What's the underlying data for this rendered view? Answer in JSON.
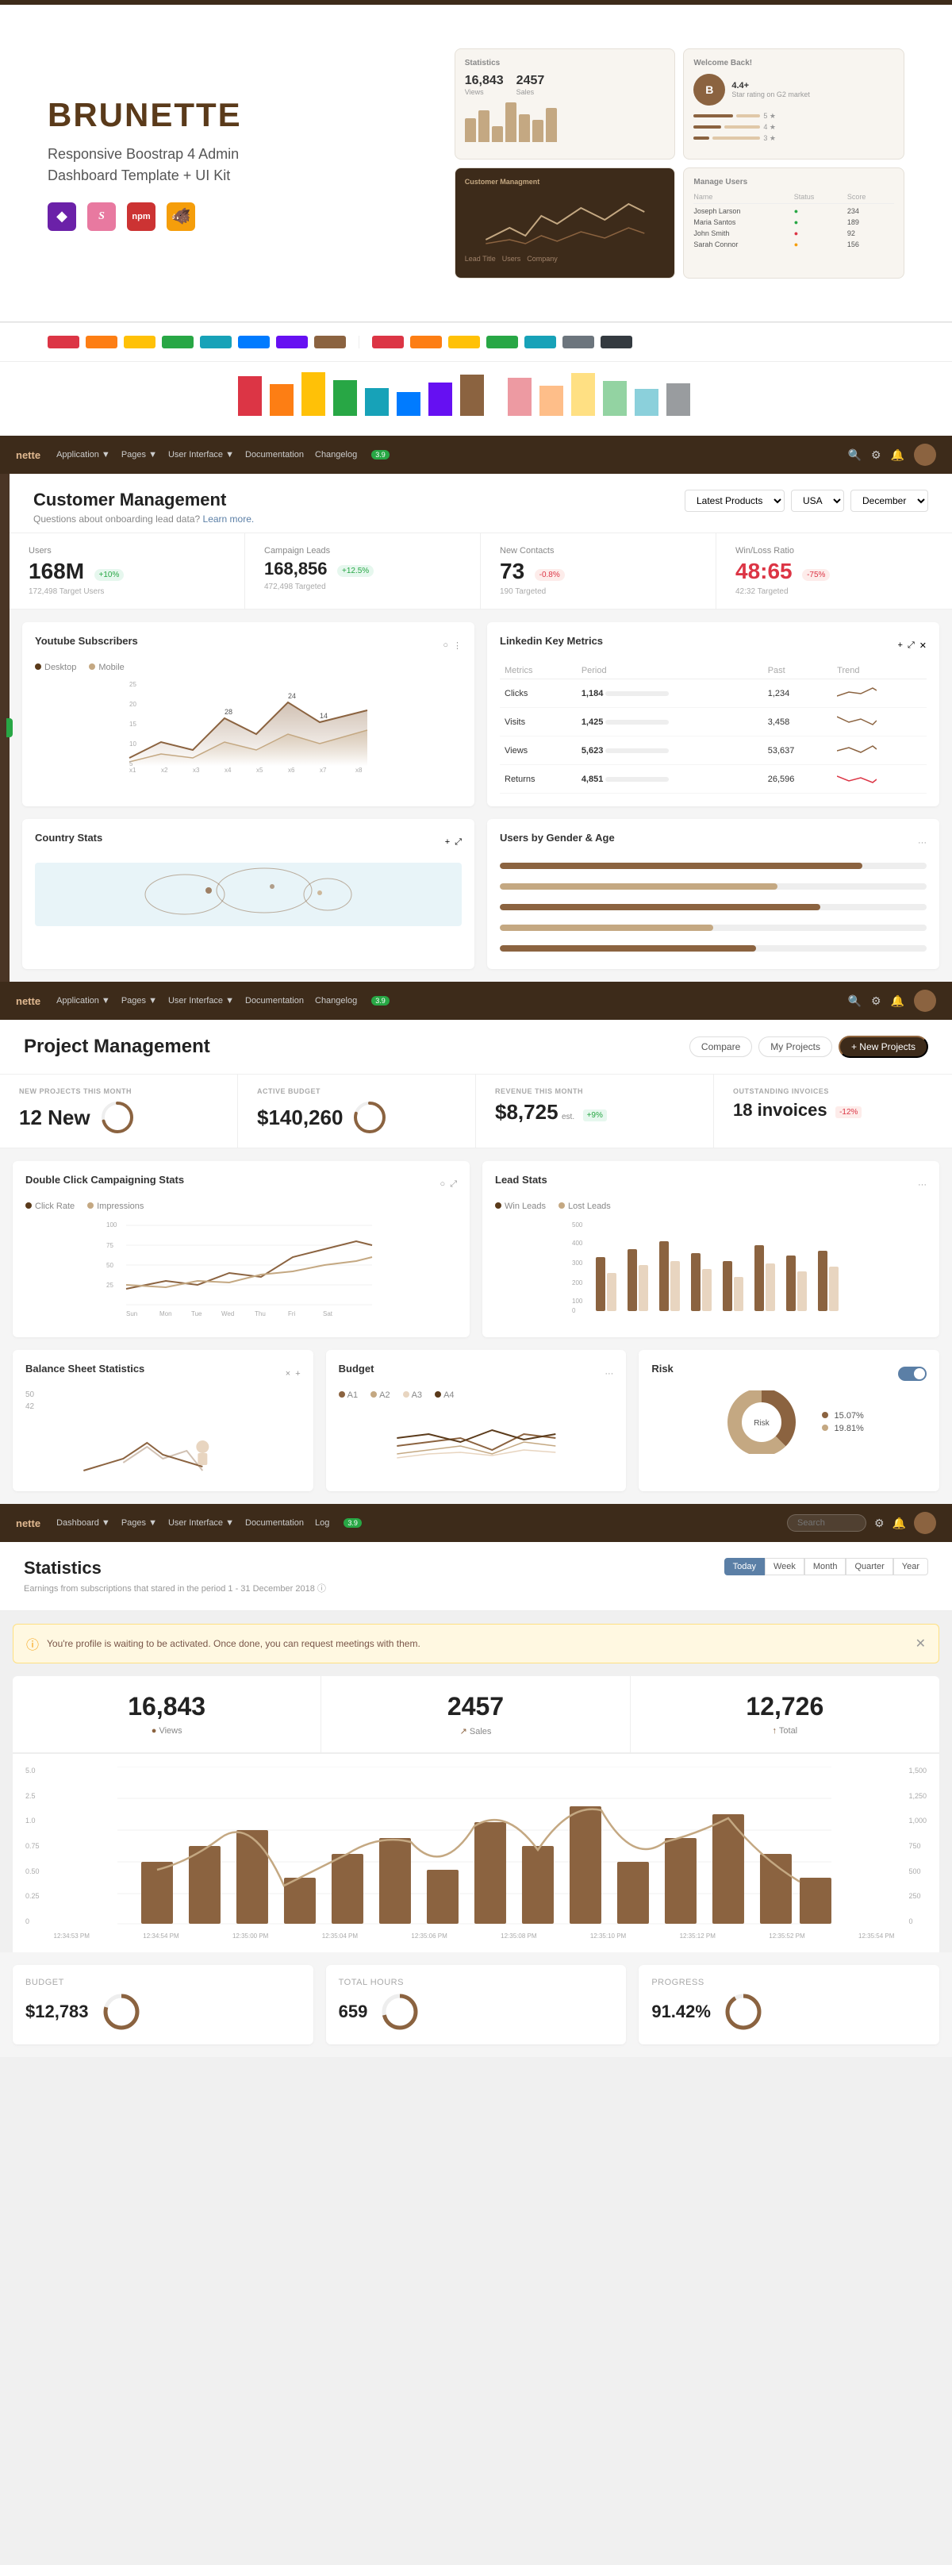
{
  "hero": {
    "title": "BRUNETTE",
    "subtitle_line1": "Responsive Boostrap 4 Admin",
    "subtitle_line2": "Dashboard Template + UI Kit",
    "tech_icons": [
      "◆",
      "Ss",
      "npm",
      "🔧"
    ]
  },
  "customer_management": {
    "title": "Customer Management",
    "subtitle": "Questions about onboarding lead data?",
    "subtitle_link": "Learn more.",
    "filters": {
      "products": "Latest Products",
      "region": "USA",
      "period": "December"
    },
    "stats": [
      {
        "label": "Users",
        "value": "168M",
        "badge": "+10%",
        "badge_type": "green",
        "sub": "172,498 Target Users"
      },
      {
        "label": "Campaign Leads",
        "value": "168,856",
        "badge": "+12.5%",
        "badge_type": "green",
        "sub": "472,498 Targeted"
      },
      {
        "label": "New Contacts",
        "value": "73",
        "badge": "-0.8%",
        "badge_type": "red",
        "sub": "190 Targeted"
      },
      {
        "label": "Win/Loss Ratio",
        "value": "48:65",
        "badge": "-75%",
        "badge_type": "red",
        "sub": "42:32 Targeted"
      }
    ],
    "youtube": {
      "title": "Youtube Subscribers",
      "legend": [
        "Desktop",
        "Mobile"
      ]
    },
    "linkedin": {
      "title": "Linkedin Key Metrics",
      "columns": [
        "Metrics",
        "Period",
        "Past",
        "Trend"
      ],
      "rows": [
        {
          "metric": "Clicks",
          "period": "1,184",
          "past": "1,234",
          "bar_pct": 70,
          "bar_type": "brown"
        },
        {
          "metric": "Visits",
          "period": "1,425",
          "past": "3,458",
          "bar_pct": 30,
          "bar_type": "brown"
        },
        {
          "metric": "Views",
          "period": "5,623",
          "past": "53,637",
          "bar_pct": 60,
          "bar_type": "brown"
        },
        {
          "metric": "Returns",
          "period": "4,851",
          "past": "26,596",
          "bar_pct": 15,
          "bar_type": "red"
        }
      ]
    },
    "country_stats": {
      "title": "Country Stats"
    },
    "gender_age": {
      "title": "Users by Gender & Age",
      "bars": [
        {
          "label": "",
          "pct": 85
        },
        {
          "label": "",
          "pct": 65
        },
        {
          "label": "",
          "pct": 75
        },
        {
          "label": "",
          "pct": 50
        },
        {
          "label": "",
          "pct": 60
        }
      ]
    }
  },
  "project_management": {
    "title": "Project Management",
    "buttons": {
      "compare": "Compare",
      "my_projects": "My Projects",
      "new_project": "+ New Projects"
    },
    "kpis": [
      {
        "label": "NEW PROJECTS THIS MONTH",
        "value": "12 New",
        "sub": ""
      },
      {
        "label": "ACTIVE BUDGET",
        "value": "$140,260",
        "sub": ""
      },
      {
        "label": "REVENUE THIS MONTH",
        "value": "$8,725",
        "sub": "est.",
        "badge": "+9%",
        "badge_type": "green"
      },
      {
        "label": "OUTSTANDING INVOICES",
        "value": "18 invoices",
        "badge": "-12%",
        "badge_type": "red"
      }
    ],
    "double_click": {
      "title": "Double Click Campaigning Stats",
      "legend": [
        "Click Rate",
        "Impressions"
      ],
      "x_labels": [
        "Sun",
        "Mon",
        "Tue",
        "Wed",
        "Thu",
        "Fri",
        "Sat"
      ]
    },
    "lead_stats": {
      "title": "Lead Stats",
      "legend": [
        "Win Leads",
        "Lost Leads"
      ],
      "y_labels": [
        "500",
        "400",
        "300",
        "200",
        "100",
        "0"
      ]
    },
    "balance": {
      "title": "Balance Sheet Statistics",
      "y_values": [
        "50",
        "42"
      ]
    },
    "budget": {
      "title": "Budget",
      "legend": [
        "A1",
        "A2",
        "A3",
        "A4"
      ]
    },
    "risk": {
      "title": "Risk",
      "values": [
        "15.07%",
        "19.81%"
      ]
    }
  },
  "statistics": {
    "nav_brand": "nette",
    "nav_items": [
      "Dashboard ▼",
      "Pages ▼",
      "User Interface ▼",
      "Documentation",
      "Log"
    ],
    "notif_badge": "3.9",
    "title": "Statistics",
    "subtitle": "Earnings from subscriptions that stared in the period 1 - 31 December 2018 ⓘ",
    "period_buttons": [
      "Today",
      "Week",
      "Month",
      "Quarter",
      "Year"
    ],
    "active_period": "Today",
    "alert": "You're profile is waiting to be activated. Once done, you can request meetings with them.",
    "kpis": [
      {
        "value": "16,843",
        "label": "● Views",
        "icon_type": "views"
      },
      {
        "value": "2457",
        "label": "↗ Sales",
        "icon_type": "sales"
      },
      {
        "value": "12,726",
        "label": "↑ Total",
        "icon_type": "total"
      }
    ],
    "chart": {
      "x_labels": [
        "12:34:53 PM",
        "12:34:54 PM",
        "12:35:00 PM",
        "12:35:04 PM",
        "12:35:06 PM",
        "12:35:08 PM",
        "12:35:10 PM",
        "12:35:12 PM",
        "12:35:52 PM",
        "12:35:54 PM"
      ],
      "y_left": [
        "5.0",
        "2.5",
        "1.0",
        "0.75",
        "0.50",
        "0.25",
        "0"
      ],
      "y_right": [
        "1,500",
        "1,250",
        "1,000",
        "750",
        "500",
        "250",
        "0"
      ]
    },
    "bottom": [
      {
        "label": "BUDGET",
        "value": "$12,783",
        "has_donut": true
      },
      {
        "label": "TOTAL HOURS",
        "value": "659",
        "has_donut": true
      },
      {
        "label": "PROGRESS",
        "value": "91.42%",
        "has_donut": true
      }
    ]
  }
}
